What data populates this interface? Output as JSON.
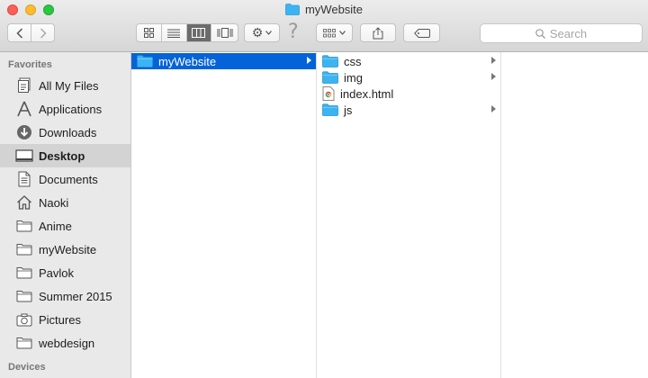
{
  "window": {
    "title": "myWebsite"
  },
  "colors": {
    "folder": "#3db4f2",
    "selection": "#0463d8",
    "sidebar_bg": "#e9e9e9"
  },
  "toolbar": {
    "nav": [
      "back",
      "forward"
    ],
    "views": [
      "icon-view",
      "list-view",
      "column-view",
      "cover-flow-view"
    ],
    "active_view": "column-view",
    "action_icon": "gear-icon",
    "arrange_icon": "arrange-grid-icon",
    "share_icon": "share-icon",
    "tag_icon": "tag-icon",
    "help_glyph": "?"
  },
  "search": {
    "placeholder": "Search"
  },
  "sidebar": {
    "favorites_label": "Favorites",
    "items": [
      {
        "label": "All My Files",
        "icon": "all-files-icon"
      },
      {
        "label": "Applications",
        "icon": "applications-icon"
      },
      {
        "label": "Downloads",
        "icon": "downloads-icon"
      },
      {
        "label": "Desktop",
        "icon": "desktop-icon",
        "selected": true
      },
      {
        "label": "Documents",
        "icon": "documents-icon"
      },
      {
        "label": "Naoki",
        "icon": "home-icon"
      },
      {
        "label": "Anime",
        "icon": "folder-icon"
      },
      {
        "label": "myWebsite",
        "icon": "folder-icon"
      },
      {
        "label": "Pavlok",
        "icon": "folder-icon"
      },
      {
        "label": "Summer 2015",
        "icon": "folder-icon"
      },
      {
        "label": "Pictures",
        "icon": "camera-icon"
      },
      {
        "label": "webdesign",
        "icon": "folder-icon"
      }
    ],
    "devices_label": "Devices"
  },
  "columns": [
    {
      "items": [
        {
          "name": "myWebsite",
          "type": "folder",
          "selected": true,
          "has_children": true
        }
      ]
    },
    {
      "items": [
        {
          "name": "css",
          "type": "folder",
          "has_children": true
        },
        {
          "name": "img",
          "type": "folder",
          "has_children": true
        },
        {
          "name": "index.html",
          "type": "html-file",
          "has_children": false
        },
        {
          "name": "js",
          "type": "folder",
          "has_children": true
        }
      ]
    },
    {
      "items": []
    }
  ]
}
